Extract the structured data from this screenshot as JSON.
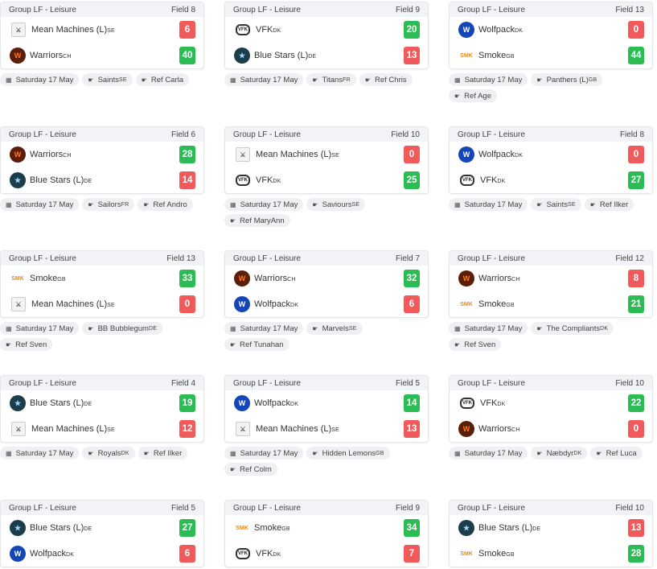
{
  "group_label": "Group LF - Leisure",
  "date": "Saturday 17 May",
  "colors": {
    "win": "#2bbd54",
    "lose": "#f05a5a",
    "header_bg": "#f1f3f6",
    "chip_bg": "#eef0f3"
  },
  "icons": {
    "date": "calendar-icon",
    "whistle": "whistle-icon"
  },
  "matches": [
    {
      "field": "Field 8",
      "teams": [
        {
          "name": "Mean Machines (L)",
          "cc": "SE",
          "logo": "mean",
          "score": "6",
          "win": false
        },
        {
          "name": "Warriors",
          "cc": "CH",
          "logo": "warriors",
          "score": "40",
          "win": true
        }
      ],
      "officials": [
        "Saints",
        "Ref Carla"
      ],
      "officials_cc": [
        "SE",
        ""
      ]
    },
    {
      "field": "Field 9",
      "teams": [
        {
          "name": "VFK",
          "cc": "DK",
          "logo": "vfk",
          "score": "20",
          "win": true
        },
        {
          "name": "Blue Stars (L)",
          "cc": "DE",
          "logo": "bluestars",
          "score": "13",
          "win": false
        }
      ],
      "officials": [
        "Titans",
        "Ref Chris"
      ],
      "officials_cc": [
        "FR",
        ""
      ]
    },
    {
      "field": "Field 13",
      "teams": [
        {
          "name": "Wolfpack",
          "cc": "DK",
          "logo": "wolfpack",
          "score": "0",
          "win": false
        },
        {
          "name": "Smoke",
          "cc": "GB",
          "logo": "smoke",
          "score": "44",
          "win": true
        }
      ],
      "officials": [
        "Panthers (L)",
        "Ref Age"
      ],
      "officials_cc": [
        "GB",
        ""
      ]
    },
    {
      "field": "Field 6",
      "teams": [
        {
          "name": "Warriors",
          "cc": "CH",
          "logo": "warriors",
          "score": "28",
          "win": true
        },
        {
          "name": "Blue Stars (L)",
          "cc": "DE",
          "logo": "bluestars",
          "score": "14",
          "win": false
        }
      ],
      "officials": [
        "Sailors",
        "Ref Andro"
      ],
      "officials_cc": [
        "FR",
        ""
      ]
    },
    {
      "field": "Field 10",
      "teams": [
        {
          "name": "Mean Machines (L)",
          "cc": "SE",
          "logo": "mean",
          "score": "0",
          "win": false
        },
        {
          "name": "VFK",
          "cc": "DK",
          "logo": "vfk",
          "score": "25",
          "win": true
        }
      ],
      "officials": [
        "Saviours",
        "Ref MaryAnn"
      ],
      "officials_cc": [
        "SE",
        ""
      ]
    },
    {
      "field": "Field 8",
      "teams": [
        {
          "name": "Wolfpack",
          "cc": "DK",
          "logo": "wolfpack",
          "score": "0",
          "win": false
        },
        {
          "name": "VFK",
          "cc": "DK",
          "logo": "vfk",
          "score": "27",
          "win": true
        }
      ],
      "officials": [
        "Saints",
        "Ref Ilker"
      ],
      "officials_cc": [
        "SE",
        ""
      ]
    },
    {
      "field": "Field 13",
      "teams": [
        {
          "name": "Smoke",
          "cc": "GB",
          "logo": "smoke",
          "score": "33",
          "win": true
        },
        {
          "name": "Mean Machines (L)",
          "cc": "SE",
          "logo": "mean",
          "score": "0",
          "win": false
        }
      ],
      "officials": [
        "BB Bubblegum",
        "Ref Sven"
      ],
      "officials_cc": [
        "DE",
        ""
      ]
    },
    {
      "field": "Field 7",
      "teams": [
        {
          "name": "Warriors",
          "cc": "CH",
          "logo": "warriors",
          "score": "32",
          "win": true
        },
        {
          "name": "Wolfpack",
          "cc": "DK",
          "logo": "wolfpack",
          "score": "6",
          "win": false
        }
      ],
      "officials": [
        "Marvels",
        "Ref Tunahan"
      ],
      "officials_cc": [
        "SE",
        ""
      ]
    },
    {
      "field": "Field 12",
      "teams": [
        {
          "name": "Warriors",
          "cc": "CH",
          "logo": "warriors",
          "score": "8",
          "win": false
        },
        {
          "name": "Smoke",
          "cc": "GB",
          "logo": "smoke",
          "score": "21",
          "win": true
        }
      ],
      "officials": [
        "The Compliants",
        "Ref Sven"
      ],
      "officials_cc": [
        "DK",
        ""
      ]
    },
    {
      "field": "Field 4",
      "teams": [
        {
          "name": "Blue Stars (L)",
          "cc": "DE",
          "logo": "bluestars",
          "score": "19",
          "win": true
        },
        {
          "name": "Mean Machines (L)",
          "cc": "SE",
          "logo": "mean",
          "score": "12",
          "win": false
        }
      ],
      "officials": [
        "Royals",
        "Ref Ilker"
      ],
      "officials_cc": [
        "DK",
        ""
      ]
    },
    {
      "field": "Field 5",
      "teams": [
        {
          "name": "Wolfpack",
          "cc": "DK",
          "logo": "wolfpack",
          "score": "14",
          "win": true
        },
        {
          "name": "Mean Machines (L)",
          "cc": "SE",
          "logo": "mean",
          "score": "13",
          "win": false
        }
      ],
      "officials": [
        "Hidden Lemons",
        "Ref Colm"
      ],
      "officials_cc": [
        "GB",
        ""
      ]
    },
    {
      "field": "Field 10",
      "teams": [
        {
          "name": "VFK",
          "cc": "DK",
          "logo": "vfk",
          "score": "22",
          "win": true
        },
        {
          "name": "Warriors",
          "cc": "CH",
          "logo": "warriors",
          "score": "0",
          "win": false
        }
      ],
      "officials": [
        "Næbdyr",
        "Ref Luca"
      ],
      "officials_cc": [
        "DK",
        ""
      ]
    },
    {
      "field": "Field 5",
      "teams": [
        {
          "name": "Blue Stars (L)",
          "cc": "DE",
          "logo": "bluestars",
          "score": "27",
          "win": true
        },
        {
          "name": "Wolfpack",
          "cc": "DK",
          "logo": "wolfpack",
          "score": "6",
          "win": false
        }
      ],
      "officials": [],
      "officials_cc": []
    },
    {
      "field": "Field 9",
      "teams": [
        {
          "name": "Smoke",
          "cc": "GB",
          "logo": "smoke",
          "score": "34",
          "win": true
        },
        {
          "name": "VFK",
          "cc": "DK",
          "logo": "vfk",
          "score": "7",
          "win": false
        }
      ],
      "officials": [],
      "officials_cc": []
    },
    {
      "field": "Field 10",
      "teams": [
        {
          "name": "Blue Stars (L)",
          "cc": "DE",
          "logo": "bluestars",
          "score": "13",
          "win": false
        },
        {
          "name": "Smoke",
          "cc": "GB",
          "logo": "smoke",
          "score": "28",
          "win": true
        }
      ],
      "officials": [],
      "officials_cc": []
    }
  ]
}
